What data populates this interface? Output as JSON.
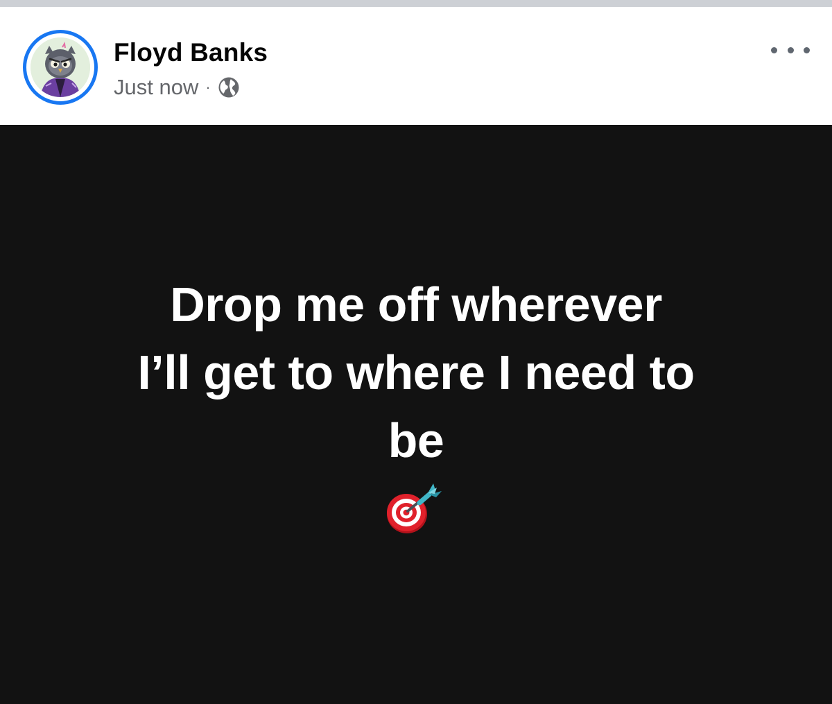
{
  "post": {
    "author_name": "Floyd Banks",
    "timestamp": "Just now",
    "separator": "·",
    "audience_icon": "globe-icon",
    "more_icon": "more-options-icon",
    "text_lines": [
      "Drop me off wherever",
      "I’ll get to where I need to",
      "be"
    ],
    "emoji": "direct-hit-emoji"
  },
  "colors": {
    "avatar_ring": "#1877f2",
    "background_post": "#121212",
    "text_post": "#ffffff",
    "meta_text": "#65676b"
  }
}
